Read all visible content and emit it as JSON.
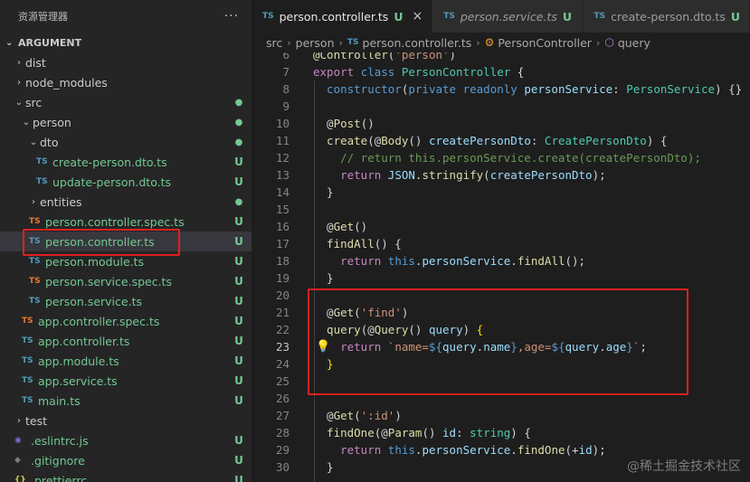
{
  "sidebar": {
    "title": "资源管理器",
    "more_label": "···",
    "root": "ARGUMENT",
    "items": [
      {
        "label": "dist",
        "indent": 1,
        "chev": "›",
        "icon": "",
        "status": ""
      },
      {
        "label": "node_modules",
        "indent": 1,
        "chev": "›",
        "icon": "",
        "status": ""
      },
      {
        "label": "src",
        "indent": 1,
        "chev": "⌄",
        "icon": "",
        "status": "●"
      },
      {
        "label": "person",
        "indent": 2,
        "chev": "⌄",
        "icon": "",
        "status": "●"
      },
      {
        "label": "dto",
        "indent": 3,
        "chev": "⌄",
        "icon": "",
        "status": "●"
      },
      {
        "label": "create-person.dto.ts",
        "indent": 4,
        "chev": "",
        "icon": "TS",
        "status": "U"
      },
      {
        "label": "update-person.dto.ts",
        "indent": 4,
        "chev": "",
        "icon": "TS",
        "status": "U"
      },
      {
        "label": "entities",
        "indent": 3,
        "chev": "›",
        "icon": "",
        "status": "●"
      },
      {
        "label": "person.controller.spec.ts",
        "indent": 3,
        "chev": "",
        "icon": "TS",
        "status": "U"
      },
      {
        "label": "person.controller.ts",
        "indent": 3,
        "chev": "",
        "icon": "TS",
        "status": "U"
      },
      {
        "label": "person.module.ts",
        "indent": 3,
        "chev": "",
        "icon": "TS",
        "status": "U"
      },
      {
        "label": "person.service.spec.ts",
        "indent": 3,
        "chev": "",
        "icon": "TS",
        "status": "U"
      },
      {
        "label": "person.service.ts",
        "indent": 3,
        "chev": "",
        "icon": "TS",
        "status": "U"
      },
      {
        "label": "app.controller.spec.ts",
        "indent": 2,
        "chev": "",
        "icon": "TS",
        "status": "U"
      },
      {
        "label": "app.controller.ts",
        "indent": 2,
        "chev": "",
        "icon": "TS",
        "status": "U"
      },
      {
        "label": "app.module.ts",
        "indent": 2,
        "chev": "",
        "icon": "TS",
        "status": "U"
      },
      {
        "label": "app.service.ts",
        "indent": 2,
        "chev": "",
        "icon": "TS",
        "status": "U"
      },
      {
        "label": "main.ts",
        "indent": 2,
        "chev": "",
        "icon": "TS",
        "status": "U"
      },
      {
        "label": "test",
        "indent": 1,
        "chev": "›",
        "icon": "",
        "status": ""
      },
      {
        "label": ".eslintrc.js",
        "indent": 1,
        "chev": "",
        "icon": "◉",
        "status": "U"
      },
      {
        "label": ".gitignore",
        "indent": 1,
        "chev": "",
        "icon": "◆",
        "status": "U"
      },
      {
        "label": ".prettierrc",
        "indent": 1,
        "chev": "",
        "icon": "{}",
        "status": "U"
      }
    ]
  },
  "tabs": [
    {
      "icon": "TS",
      "label": "person.controller.ts",
      "badge": "U",
      "close": "×"
    },
    {
      "icon": "TS",
      "label": "person.service.ts",
      "badge": "U"
    },
    {
      "icon": "TS",
      "label": "create-person.dto.ts",
      "badge": "U"
    }
  ],
  "breadcrumb": {
    "parts": [
      "src",
      "person",
      "person.controller.ts",
      "PersonController",
      "query"
    ],
    "sep": "›"
  },
  "code_lines": [
    {
      "n": "6",
      "segs": [
        [
          "@Controller",
          "k-fn"
        ],
        [
          "(",
          "k-punc"
        ],
        [
          "'person'",
          "k-str"
        ],
        [
          ")",
          "k-punc"
        ]
      ]
    },
    {
      "n": "7",
      "segs": [
        [
          "export ",
          "k-ctrl"
        ],
        [
          "class ",
          "k-kw"
        ],
        [
          "PersonController ",
          "k-type"
        ],
        [
          "{",
          "k-punc"
        ]
      ]
    },
    {
      "n": "8",
      "segs": [
        [
          "  constructor",
          "k-kw"
        ],
        [
          "(",
          "k-punc"
        ],
        [
          "private ",
          "k-kw"
        ],
        [
          "readonly ",
          "k-kw"
        ],
        [
          "personService",
          "k-var"
        ],
        [
          ": ",
          "k-punc"
        ],
        [
          "PersonService",
          "k-type"
        ],
        [
          ") {}",
          "k-punc"
        ]
      ]
    },
    {
      "n": "9",
      "segs": []
    },
    {
      "n": "10",
      "segs": [
        [
          "  @",
          "k-punc"
        ],
        [
          "Post",
          "k-fn"
        ],
        [
          "()",
          "k-punc"
        ]
      ]
    },
    {
      "n": "11",
      "segs": [
        [
          "  create",
          "k-fn"
        ],
        [
          "(@",
          "k-punc"
        ],
        [
          "Body",
          "k-fn"
        ],
        [
          "() ",
          "k-punc"
        ],
        [
          "createPersonDto",
          "k-var"
        ],
        [
          ": ",
          "k-punc"
        ],
        [
          "CreatePersonDto",
          "k-type"
        ],
        [
          ") {",
          "k-punc"
        ]
      ]
    },
    {
      "n": "12",
      "segs": [
        [
          "    // return this.personService.create(createPersonDto);",
          "k-com"
        ]
      ]
    },
    {
      "n": "13",
      "segs": [
        [
          "    return ",
          "k-ctrl"
        ],
        [
          "JSON",
          "k-var"
        ],
        [
          ".",
          "k-punc"
        ],
        [
          "stringify",
          "k-fn"
        ],
        [
          "(",
          "k-punc"
        ],
        [
          "createPersonDto",
          "k-var"
        ],
        [
          ");",
          "k-punc"
        ]
      ]
    },
    {
      "n": "14",
      "segs": [
        [
          "  }",
          "k-punc"
        ]
      ]
    },
    {
      "n": "15",
      "segs": []
    },
    {
      "n": "16",
      "segs": [
        [
          "  @",
          "k-punc"
        ],
        [
          "Get",
          "k-fn"
        ],
        [
          "()",
          "k-punc"
        ]
      ]
    },
    {
      "n": "17",
      "segs": [
        [
          "  findAll",
          "k-fn"
        ],
        [
          "() {",
          "k-punc"
        ]
      ]
    },
    {
      "n": "18",
      "segs": [
        [
          "    return ",
          "k-ctrl"
        ],
        [
          "this",
          "k-kw"
        ],
        [
          ".",
          "k-punc"
        ],
        [
          "personService",
          "k-var"
        ],
        [
          ".",
          "k-punc"
        ],
        [
          "findAll",
          "k-fn"
        ],
        [
          "();",
          "k-punc"
        ]
      ]
    },
    {
      "n": "19",
      "segs": [
        [
          "  }",
          "k-punc"
        ]
      ]
    },
    {
      "n": "20",
      "segs": []
    },
    {
      "n": "21",
      "segs": [
        [
          "  @",
          "k-punc"
        ],
        [
          "Get",
          "k-fn"
        ],
        [
          "(",
          "k-punc"
        ],
        [
          "'find'",
          "k-str"
        ],
        [
          ")",
          "k-punc"
        ]
      ]
    },
    {
      "n": "22",
      "segs": [
        [
          "  query",
          "k-fn"
        ],
        [
          "(@",
          "k-punc"
        ],
        [
          "Query",
          "k-fn"
        ],
        [
          "() ",
          "k-punc"
        ],
        [
          "query",
          "k-var"
        ],
        [
          ") ",
          "k-punc"
        ],
        [
          "{",
          "k-brk"
        ]
      ]
    },
    {
      "n": "23",
      "segs": [
        [
          "    return ",
          "k-ctrl"
        ],
        [
          "`name=",
          "k-str"
        ],
        [
          "${",
          "k-kw"
        ],
        [
          "query",
          "k-var"
        ],
        [
          ".",
          "k-punc"
        ],
        [
          "name",
          "k-var"
        ],
        [
          "}",
          "k-kw"
        ],
        [
          ",age=",
          "k-str"
        ],
        [
          "${",
          "k-kw"
        ],
        [
          "query",
          "k-var"
        ],
        [
          ".",
          "k-punc"
        ],
        [
          "age",
          "k-var"
        ],
        [
          "}",
          "k-kw"
        ],
        [
          "`",
          "k-str"
        ],
        [
          ";",
          "k-punc"
        ]
      ]
    },
    {
      "n": "24",
      "segs": [
        [
          "  }",
          "k-brk"
        ]
      ]
    },
    {
      "n": "25",
      "segs": []
    },
    {
      "n": "26",
      "segs": []
    },
    {
      "n": "27",
      "segs": [
        [
          "  @",
          "k-punc"
        ],
        [
          "Get",
          "k-fn"
        ],
        [
          "(",
          "k-punc"
        ],
        [
          "':id'",
          "k-str"
        ],
        [
          ")",
          "k-punc"
        ]
      ]
    },
    {
      "n": "28",
      "segs": [
        [
          "  findOne",
          "k-fn"
        ],
        [
          "(@",
          "k-punc"
        ],
        [
          "Param",
          "k-fn"
        ],
        [
          "() ",
          "k-punc"
        ],
        [
          "id",
          "k-var"
        ],
        [
          ": ",
          "k-punc"
        ],
        [
          "string",
          "k-type"
        ],
        [
          ") {",
          "k-punc"
        ]
      ]
    },
    {
      "n": "29",
      "segs": [
        [
          "    return ",
          "k-ctrl"
        ],
        [
          "this",
          "k-kw"
        ],
        [
          ".",
          "k-punc"
        ],
        [
          "personService",
          "k-var"
        ],
        [
          ".",
          "k-punc"
        ],
        [
          "findOne",
          "k-fn"
        ],
        [
          "(+",
          "k-punc"
        ],
        [
          "id",
          "k-var"
        ],
        [
          ");",
          "k-punc"
        ]
      ]
    },
    {
      "n": "30",
      "segs": [
        [
          "  }",
          "k-punc"
        ]
      ]
    }
  ],
  "current_line": "23",
  "watermark": "@稀土掘金技术社区",
  "colors": {
    "editor_bg": "#1e1e1e",
    "sidebar_bg": "#252526",
    "highlight_border": "#e02020",
    "untracked_green": "#73c991",
    "ts_blue": "#519aba",
    "ts_orange": "#e37933"
  }
}
